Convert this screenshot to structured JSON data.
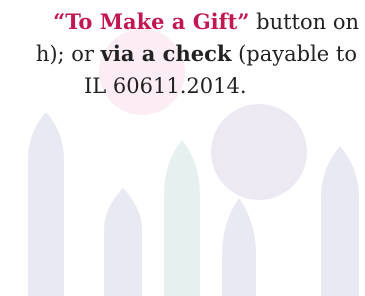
{
  "text": {
    "line1": {
      "link": "“To Make a Gift”",
      "rest": " button on"
    },
    "line2": {
      "pre": "h); or ",
      "bold": "via a check",
      "post": " (payable to"
    },
    "line3": "IL 60611.2014."
  },
  "colors": {
    "link": "#c2184f",
    "text": "#222222",
    "circle_pink": "#fcecf3",
    "circle_lavender": "#ede9f3",
    "arch_lavender": "#e8e9f2",
    "arch_teal": "#e6f1ef"
  }
}
